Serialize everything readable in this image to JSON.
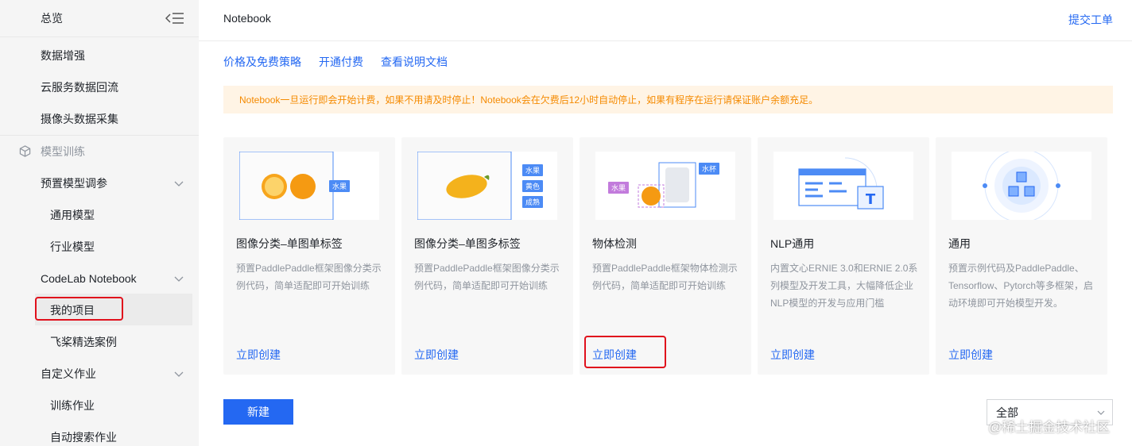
{
  "sidebar": {
    "items": [
      {
        "label": "总览"
      },
      {
        "label": "数据增强"
      },
      {
        "label": "云服务数据回流"
      },
      {
        "label": "摄像头数据采集"
      },
      {
        "label": "模型训练"
      },
      {
        "label": "预置模型调参"
      },
      {
        "label": "通用模型"
      },
      {
        "label": "行业模型"
      },
      {
        "label": "CodeLab Notebook"
      },
      {
        "label": "我的项目"
      },
      {
        "label": "飞桨精选案例"
      },
      {
        "label": "自定义作业"
      },
      {
        "label": "训练作业"
      },
      {
        "label": "自动搜索作业"
      }
    ]
  },
  "header": {
    "title": "Notebook",
    "submit_ticket": "提交工单"
  },
  "links": {
    "pricing": "价格及免费策略",
    "activate": "开通付费",
    "docs": "查看说明文档"
  },
  "notice": "Notebook一旦运行即会开始计费，如果不用请及时停止！Notebook会在欠费后12小时自动停止，如果有程序在运行请保证账户余额充足。",
  "cards": [
    {
      "title": "图像分类–单图单标签",
      "desc": "预置PaddlePaddle框架图像分类示例代码，简单适配即可开始训练",
      "create": "立即创建",
      "tags": [
        "水果"
      ]
    },
    {
      "title": "图像分类–单图多标签",
      "desc": "预置PaddlePaddle框架图像分类示例代码，简单适配即可开始训练",
      "create": "立即创建",
      "tags": [
        "水果",
        "黄色",
        "成熟"
      ]
    },
    {
      "title": "物体检测",
      "desc": "预置PaddlePaddle框架物体检测示例代码，简单适配即可开始训练",
      "create": "立即创建",
      "tags": [
        "水果",
        "水杯"
      ]
    },
    {
      "title": "NLP通用",
      "desc": "内置文心ERNIE 3.0和ERNIE 2.0系列模型及开发工具，大幅降低企业NLP模型的开发与应用门槛",
      "create": "立即创建",
      "tags": []
    },
    {
      "title": "通用",
      "desc": "预置示例代码及PaddlePaddle、Tensorflow、Pytorch等多框架，启动环境即可开始模型开发。",
      "create": "立即创建",
      "tags": []
    }
  ],
  "footer": {
    "new_button": "新建",
    "filter_value": "全部"
  },
  "watermark": "@稀土掘金技术社区",
  "colors": {
    "accent": "#2468f2",
    "notice_bg": "#fff4e5",
    "notice_text": "#f58a00",
    "highlight": "#e0101c"
  }
}
